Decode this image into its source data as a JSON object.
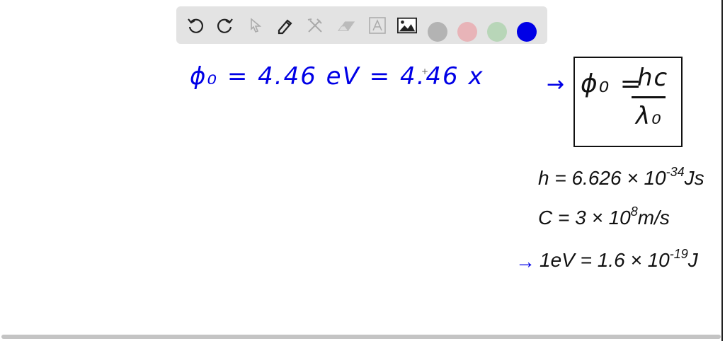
{
  "toolbar": {
    "tools": [
      "undo-icon",
      "redo-icon",
      "select-icon",
      "pen-icon",
      "tools-icon",
      "eraser-icon",
      "text-icon",
      "image-icon"
    ],
    "colors": [
      "#b3b3b3",
      "#e8b4b8",
      "#b8d6b8",
      "#0000e6"
    ],
    "selected_color": "#0000e6"
  },
  "board": {
    "left_equation": "ϕ₀ = 4.46 eV = 4.46 x",
    "cursor": "+",
    "boxed_formula": {
      "lhs": "ϕ₀ =",
      "numerator": "hc",
      "denominator": "λ₀"
    },
    "arrow": "→",
    "h_value": "h = 6.626 × 10",
    "h_exp": "-34",
    "h_unit": "Js",
    "c_value": "C = 3 × 10",
    "c_exp": "8",
    "c_unit": "m/s",
    "ev_value": "1eV = 1.6 × 10",
    "ev_exp": "-19",
    "ev_unit": "J"
  }
}
